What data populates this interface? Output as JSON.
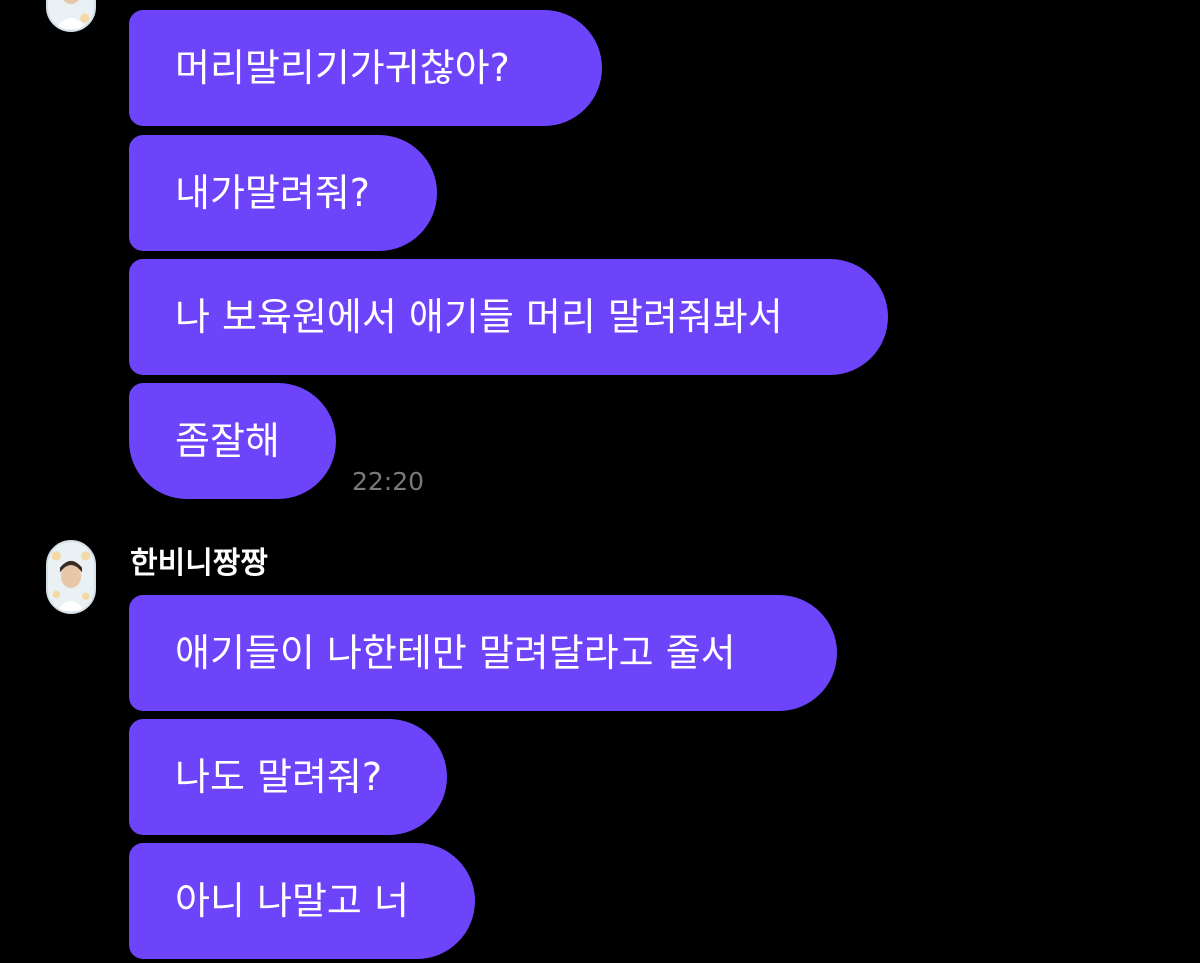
{
  "messages_group_1": [
    {
      "text": "머리말리기가귀찮아?"
    },
    {
      "text": "내가말려줘?"
    },
    {
      "text": "나 보육원에서 애기들 머리 말려줘봐서"
    },
    {
      "text": "좀잘해"
    }
  ],
  "timestamp_group_1": "22:20",
  "sender_2": {
    "name": "한비니짱짱",
    "avatar_icon": "profile-photo-icon"
  },
  "messages_group_2": [
    {
      "text": "애기들이 나한테만 말려달라고 줄서"
    },
    {
      "text": "나도 말려줘?"
    },
    {
      "text": "아니 나말고 너"
    }
  ],
  "colors": {
    "background": "#000000",
    "bubble": "#6e44fb",
    "bubble_text": "#ffffff",
    "timestamp": "#7a7a7a"
  }
}
